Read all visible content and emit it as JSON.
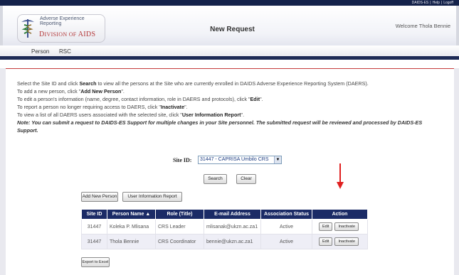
{
  "top_links": [
    "DAIDS-ES",
    "Help",
    "Logoff"
  ],
  "logo": {
    "line1": "Adverse Experience",
    "line2": "Reporting",
    "line3": "Division of AIDS"
  },
  "page_title": "New Request",
  "welcome_text": "Welcome Thola Bennie",
  "nav": {
    "tabs": [
      "Person",
      "RSC"
    ]
  },
  "instructions": {
    "line1_pre": "Select the Site ID and click ",
    "line1_bold": "Search",
    "line1_post": " to view all the persons at the Site who are currently enrolled in DAIDS Adverse Experience Reporting System (DAERS).",
    "line2_pre": "To add a new person, click \"",
    "line2_bold": "Add New Person",
    "line2_post": "\".",
    "line3_pre": "To edit a person's information (name, degree, contact information, role in DAERS and protocols), click \"",
    "line3_bold": "Edit",
    "line3_post": "\".",
    "line4_pre": "To report a person no longer requiring access to DAERS, click \"",
    "line4_bold": "Inactivate",
    "line4_post": "\".",
    "line5_pre": "To view a list of all DAERS users associated with the selected site, click \"",
    "line5_bold": "User Information Report",
    "line5_post": "\".",
    "note": "Note: You can submit a request to DAIDS-ES Support for multiple changes in your Site personnel. The submitted request will be reviewed and processed by DAIDS-ES Support."
  },
  "site": {
    "label": "Site ID:",
    "selected": "31447 - CAPRISA Umbilo CRS"
  },
  "buttons": {
    "search": "Search",
    "clear": "Clear",
    "add_new_person": "Add New Person",
    "user_info_report": "User Information Report",
    "export_excel": "Export to Excel"
  },
  "table": {
    "headers": [
      "Site ID",
      "Person Name ▲",
      "Role (Title)",
      "E-mail Address",
      "Association Status",
      "Action"
    ],
    "rows": [
      {
        "site_id": "31447",
        "name": "Koleka P. Mlisana",
        "role": "CRS Leader",
        "email": "mlisanak@ukzn.ac.za1",
        "status": "Active",
        "edit": "Edit",
        "inactivate": "Inactivate"
      },
      {
        "site_id": "31447",
        "name": "Thola Bennie",
        "role": "CRS Coordinator",
        "email": "bennie@ukzn.ac.za1",
        "status": "Active",
        "edit": "Edit",
        "inactivate": "Inactivate"
      }
    ]
  },
  "colors": {
    "header_navy": "#1b2b66",
    "accent_red": "#b22222",
    "arrow_red": "#e02020"
  }
}
